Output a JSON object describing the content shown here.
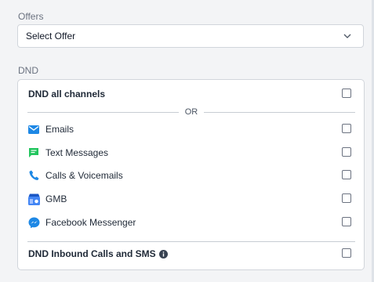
{
  "offers": {
    "label": "Offers",
    "select_value": "Select Offer"
  },
  "dnd": {
    "label": "DND",
    "all_channels_label": "DND all channels",
    "separator_text": "OR",
    "channels": [
      {
        "label": "Emails",
        "icon": "mail-icon",
        "color": "#1e88e5"
      },
      {
        "label": "Text Messages",
        "icon": "chat-icon",
        "color": "#22c55e"
      },
      {
        "label": "Calls & Voicemails",
        "icon": "phone-icon",
        "color": "#1e88e5"
      },
      {
        "label": "GMB",
        "icon": "gmb-store-icon",
        "color": "#4285f4"
      },
      {
        "label": "Facebook Messenger",
        "icon": "messenger-icon",
        "color": "#1e88e5"
      }
    ],
    "inbound_label": "DND Inbound Calls and SMS"
  }
}
